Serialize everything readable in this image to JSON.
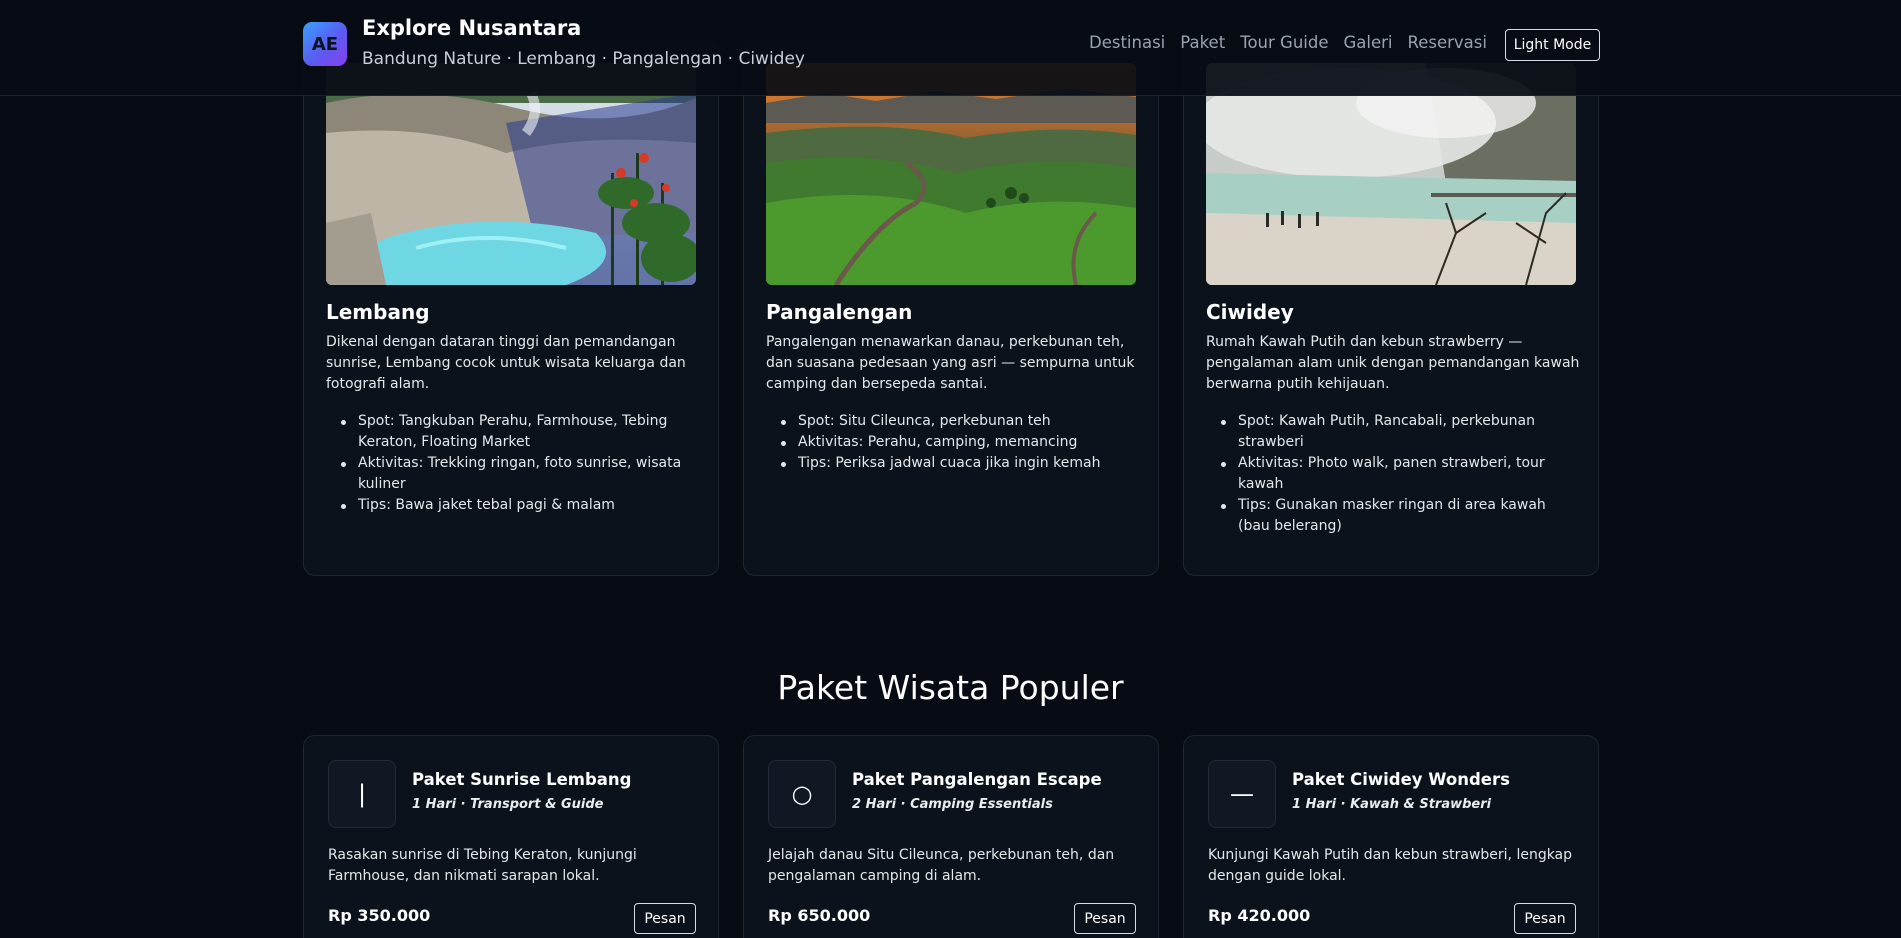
{
  "header": {
    "logo_text": "AE",
    "brand_name": "Explore Nusantara",
    "brand_sub": "Bandung Nature · Lembang · Pangalengan · Ciwidey",
    "nav": [
      "Destinasi",
      "Paket",
      "Tour Guide",
      "Galeri",
      "Reservasi"
    ],
    "mode_button": "Light Mode"
  },
  "destinations": [
    {
      "title": "Lembang",
      "description": "Dikenal dengan dataran tinggi dan pemandangan sunrise, Lembang cocok untuk wisata keluarga dan fotografi alam.",
      "bullets": [
        "Spot: Tangkuban Perahu, Farmhouse, Tebing Keraton, Floating Market",
        "Aktivitas: Trekking ringan, foto sunrise, wisata kuliner",
        "Tips: Bawa jaket tebal pagi & malam"
      ],
      "image": "crater-lake-photo"
    },
    {
      "title": "Pangalengan",
      "description": "Pangalengan menawarkan danau, perkebunan teh, dan suasana pedesaan yang asri — sempurna untuk camping dan bersepeda santai.",
      "bullets": [
        "Spot: Situ Cileunca, perkebunan teh",
        "Aktivitas: Perahu, camping, memancing",
        "Tips: Periksa jadwal cuaca jika ingin kemah"
      ],
      "image": "tea-hills-sunset-photo"
    },
    {
      "title": "Ciwidey",
      "description": "Rumah Kawah Putih dan kebun strawberry — pengalaman alam unik dengan pemandangan kawah berwarna putih kehijauan.",
      "bullets": [
        "Spot: Kawah Putih, Rancabali, perkebunan strawberi",
        "Aktivitas: Photo walk, panen strawberi, tour kawah",
        "Tips: Gunakan masker ringan di area kawah (bau belerang)"
      ],
      "image": "white-crater-lake-photo"
    }
  ],
  "packages_section": {
    "title": "Paket Wisata Populer"
  },
  "packages": [
    {
      "icon": "|",
      "icon_name": "sunrise-icon",
      "name": "Paket Sunrise Lembang",
      "meta": "1 Hari · Transport & Guide",
      "description": "Rasakan sunrise di Tebing Keraton, kunjungi Farmhouse, dan nikmati sarapan lokal.",
      "price": "Rp 350.000",
      "button": "Pesan"
    },
    {
      "icon": "○",
      "icon_name": "camping-icon",
      "name": "Paket Pangalengan Escape",
      "meta": "2 Hari · Camping Essentials",
      "description": "Jelajah danau Situ Cileunca, perkebunan teh, dan pengalaman camping di alam.",
      "price": "Rp 650.000",
      "button": "Pesan"
    },
    {
      "icon": "—",
      "icon_name": "crater-icon",
      "name": "Paket Ciwidey Wonders",
      "meta": "1 Hari · Kawah & Strawberi",
      "description": "Kunjungi Kawah Putih dan kebun strawberi, lengkap dengan guide lokal.",
      "price": "Rp 420.000",
      "button": "Pesan"
    }
  ],
  "colors": {
    "background": "#060b14",
    "card": "#0c121b",
    "accent_gradient_start": "#3aa0ff",
    "accent_gradient_end": "#8b3df0"
  }
}
